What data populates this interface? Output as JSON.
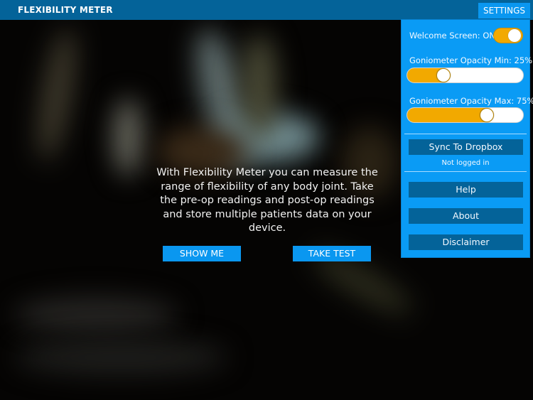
{
  "header": {
    "title": "FLEXIBILITY METER",
    "settings_label": "SETTINGS"
  },
  "main": {
    "intro_text": "With Flexibility Meter you can measure the range of flexibility of any body joint. Take the pre-op readings and post-op readings and store multiple patients data on your device.",
    "show_me_label": "SHOW ME",
    "take_test_label": "TAKE TEST"
  },
  "settings_panel": {
    "welcome_screen_label": "Welcome Screen:  ON",
    "welcome_screen_on": true,
    "opacity_min_label": "Goniometer Opacity Min: 25%",
    "opacity_min_value": 25,
    "opacity_max_label": "Goniometer Opacity Max: 75%",
    "opacity_max_value": 75,
    "sync_label": "Sync To Dropbox",
    "sync_status": "Not logged in",
    "help_label": "Help",
    "about_label": "About",
    "disclaimer_label": "Disclaimer"
  },
  "colors": {
    "header_bg": "#046399",
    "accent_blue": "#0a97f0",
    "panel_bg": "#0a9bf5",
    "panel_button_bg": "#046399",
    "toggle_on": "#f2a900"
  }
}
